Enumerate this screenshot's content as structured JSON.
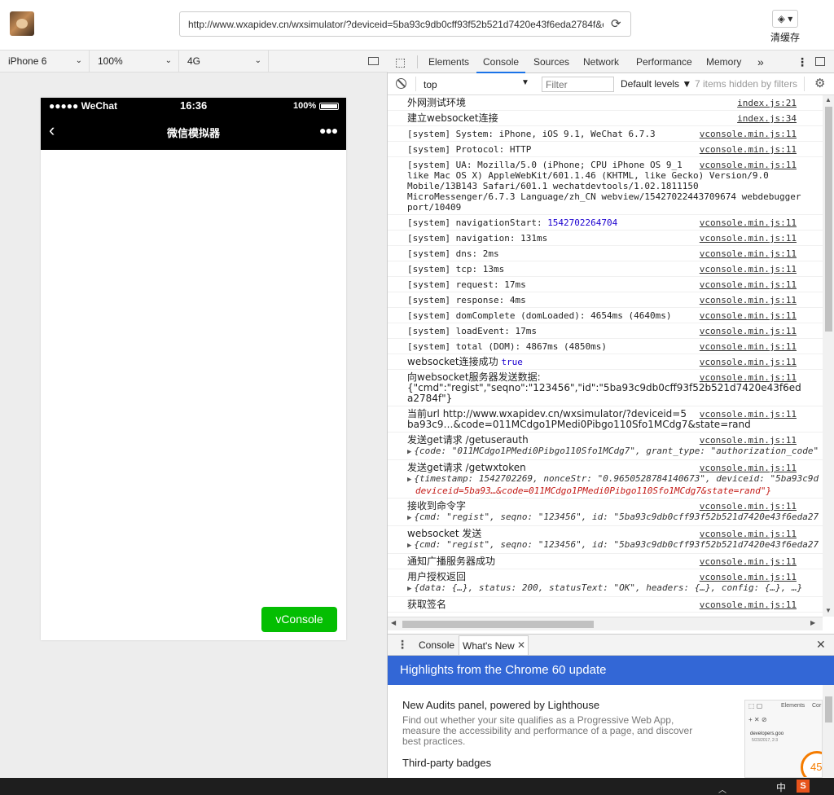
{
  "browser": {
    "url": "http://www.wxapidev.cn/wxsimulator/?deviceid=5ba93c9db0cff93f52b521d7420e43f6eda2784f&c",
    "clear_cache_label": "清缓存"
  },
  "device_bar": {
    "device": "iPhone 6",
    "zoom": "100%",
    "network": "4G"
  },
  "phone": {
    "carrier": "●●●●● WeChat",
    "time": "16:36",
    "battery": "100%",
    "nav_title": "微信模拟器",
    "vconsole_label": "vConsole"
  },
  "devtools": {
    "tabs": [
      "Elements",
      "Console",
      "Sources",
      "Network",
      "Performance",
      "Memory"
    ],
    "more": "»",
    "context": "top",
    "filter_placeholder": "Filter",
    "levels": "Default levels ▼",
    "hidden": "7 items hidden by filters"
  },
  "console_rows": [
    {
      "text": "外网测试环境",
      "src": "index.js:21"
    },
    {
      "text": "建立websocket连接",
      "src": "index.js:34"
    },
    {
      "text": "[system] System: iPhone, iOS 9.1, WeChat 6.7.3",
      "src": "vconsole.min.js:11"
    },
    {
      "text": "[system] Protocol: HTTP",
      "src": "vconsole.min.js:11"
    },
    {
      "text": "[system] UA: Mozilla/5.0 (iPhone; CPU iPhone OS 9_1\nlike Mac OS X) AppleWebKit/601.1.46 (KHTML, like Gecko) Version/9.0\nMobile/13B143 Safari/601.1 wechatdevtools/1.02.1811150\nMicroMessenger/6.7.3 Language/zh_CN webview/15427022443709674 webdebugger\nport/10409",
      "src": "vconsole.min.js:11"
    },
    {
      "text": "[system] navigationStart: ",
      "num": "1542702264704",
      "src": "vconsole.min.js:11"
    },
    {
      "text": "[system] navigation: 131ms",
      "src": "vconsole.min.js:11"
    },
    {
      "text": "[system] dns: 2ms",
      "src": "vconsole.min.js:11"
    },
    {
      "text": "[system] tcp: 13ms",
      "src": "vconsole.min.js:11"
    },
    {
      "text": "[system] request: 17ms",
      "src": "vconsole.min.js:11"
    },
    {
      "text": "[system] response: 4ms",
      "src": "vconsole.min.js:11"
    },
    {
      "text": "[system] domComplete (domLoaded): 4654ms (4640ms)",
      "src": "vconsole.min.js:11"
    },
    {
      "text": "[system] loadEvent: 17ms",
      "src": "vconsole.min.js:11"
    },
    {
      "text": "[system] total (DOM): 4867ms (4850ms)",
      "src": "vconsole.min.js:11"
    },
    {
      "text": "websocket连接成功 ",
      "num": "true",
      "src": "vconsole.min.js:11"
    },
    {
      "text": "向websocket服务器发送数据:\n{\"cmd\":\"regist\",\"seqno\":\"123456\",\"id\":\"5ba93c9db0cff93f52b521d7420e43f6ed\na2784f\"}",
      "src": "vconsole.min.js:11"
    },
    {
      "text": "当前url http://www.wxapidev.cn/wxsimulator/?deviceid=5\nba93c9…&code=011MCdgo1PMedi0Pibgo110Sfo1MCdg7&state=rand",
      "src": "vconsole.min.js:11"
    },
    {
      "text": "发送get请求 /getuserauth",
      "obj": "{code: \"011MCdgo1PMedi0Pibgo110Sfo1MCdg7\", grant_type: \"authorization_code\"",
      "src": "vconsole.min.js:11"
    },
    {
      "text": "发送get请求 /getwxtoken",
      "obj": "{timestamp: 1542702269, nonceStr: \"0.9650528784140673\", deviceid: \"5ba93c9d",
      "obj2": "deviceid=5ba93…&code=011MCdgo1PMedi0Pibgo110Sfo1MCdg7&state=rand\"}",
      "src": "vconsole.min.js:11"
    },
    {
      "text": "接收到命令字",
      "obj": "{cmd: \"regist\", seqno: \"123456\", id: \"5ba93c9db0cff93f52b521d7420e43f6eda27",
      "src": "vconsole.min.js:11"
    },
    {
      "text": "websocket 发送",
      "obj": "{cmd: \"regist\", seqno: \"123456\", id: \"5ba93c9db0cff93f52b521d7420e43f6eda27",
      "src": "vconsole.min.js:11"
    },
    {
      "text": "通知广播服务器成功",
      "src": "vconsole.min.js:11"
    },
    {
      "text": "用户授权返回",
      "obj": "{data: {…}, status: 200, statusText: \"OK\", headers: {…}, config: {…}, …}",
      "src": "vconsole.min.js:11"
    },
    {
      "text": "获取签名",
      "src": "vconsole.min.js:11"
    }
  ],
  "drawer": {
    "tabs": [
      "Console",
      "What's New"
    ],
    "banner": "Highlights from the Chrome 60 update",
    "item1_title": "New Audits panel, powered by Lighthouse",
    "item1_desc": "Find out whether your site qualifies as a Progressive Web App, measure the accessibility and performance of a page, and discover best practices.",
    "item2_title": "Third-party badges",
    "thumb_tab": "Elements",
    "thumb_tab2": "Cor",
    "thumb_site": "developers.goo",
    "thumb_date": "5/23/2017, 2:3",
    "thumb_score": "45"
  },
  "taskbar": {
    "ime": "中"
  }
}
